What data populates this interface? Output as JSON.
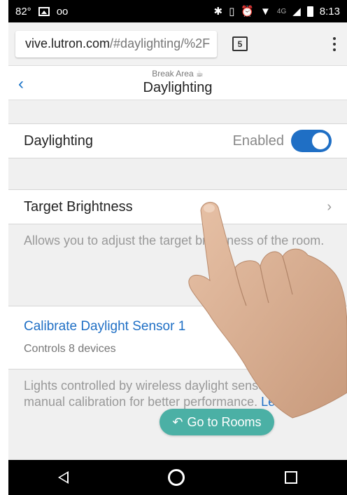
{
  "status_bar": {
    "temperature": "82°",
    "time": "8:13",
    "network": "4G"
  },
  "browser": {
    "url_host": "vive.lutron.com",
    "url_path": "/#daylighting/%2F",
    "tab_count": "5"
  },
  "header": {
    "subtitle": "Break Area ☕",
    "title": "Daylighting",
    "back_label": "‹"
  },
  "daylighting_row": {
    "label": "Daylighting",
    "state": "Enabled",
    "toggle_on": true
  },
  "target_row": {
    "label": "Target Brightness",
    "description": "Allows you to adjust the target brightness of the room."
  },
  "calibrate": {
    "link": "Calibrate Daylight Sensor 1",
    "sub": "Controls 8 devices"
  },
  "calib_desc": {
    "text": "Lights controlled by wireless daylight sensors require manual calibration for better performance. ",
    "link": "Learn"
  },
  "go_button": {
    "label": "Go to Rooms"
  },
  "colors": {
    "accent": "#1f6fc5",
    "go_button": "#4bb0a5"
  }
}
